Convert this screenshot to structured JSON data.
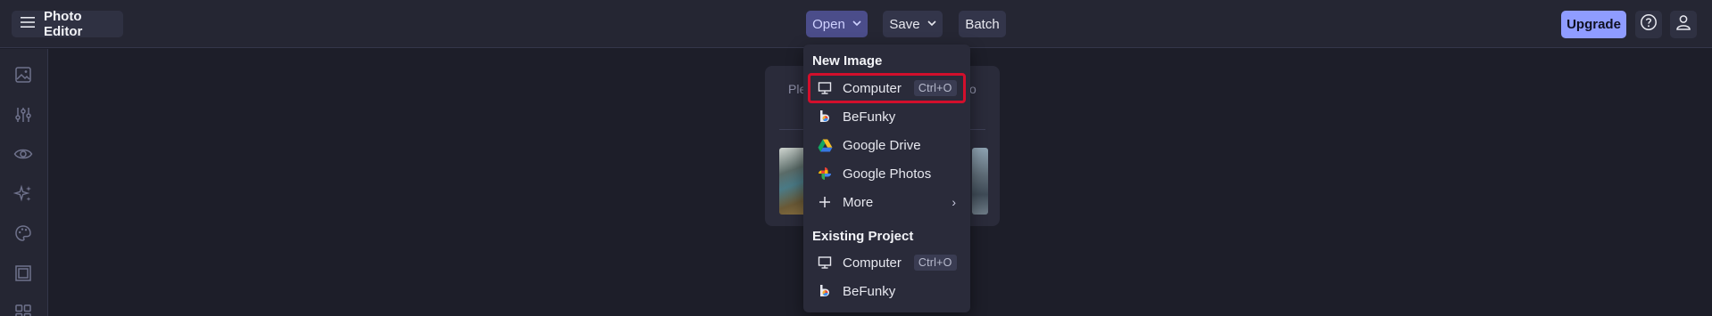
{
  "app": {
    "title": "Photo Editor"
  },
  "toolbar": {
    "open_label": "Open",
    "save_label": "Save",
    "batch_label": "Batch",
    "upgrade_label": "Upgrade"
  },
  "sidebar": {
    "items": [
      {
        "icon": "image-icon"
      },
      {
        "icon": "sliders-icon"
      },
      {
        "icon": "eye-icon"
      },
      {
        "icon": "sparkles-icon"
      },
      {
        "icon": "palette-icon"
      },
      {
        "icon": "frame-icon"
      },
      {
        "icon": "grid-icon"
      }
    ]
  },
  "card": {
    "hint_left": "Ple",
    "hint_right": "o"
  },
  "dropdown": {
    "new_image_title": "New Image",
    "new_image": [
      {
        "label": "Computer",
        "icon": "monitor-icon",
        "shortcut": "Ctrl+O"
      },
      {
        "label": "BeFunky",
        "icon": "befunky-icon"
      },
      {
        "label": "Google Drive",
        "icon": "google-drive-icon"
      },
      {
        "label": "Google Photos",
        "icon": "google-photos-icon"
      },
      {
        "label": "More",
        "icon": "plus-icon",
        "arrow": "›"
      }
    ],
    "existing_title": "Existing Project",
    "existing": [
      {
        "label": "Computer",
        "icon": "monitor-icon",
        "shortcut": "Ctrl+O"
      },
      {
        "label": "BeFunky",
        "icon": "befunky-icon"
      }
    ]
  },
  "colors": {
    "background": "#1d1e29",
    "topbar": "#252633",
    "accent": "#8f9cff",
    "highlight": "#d20f2c"
  }
}
